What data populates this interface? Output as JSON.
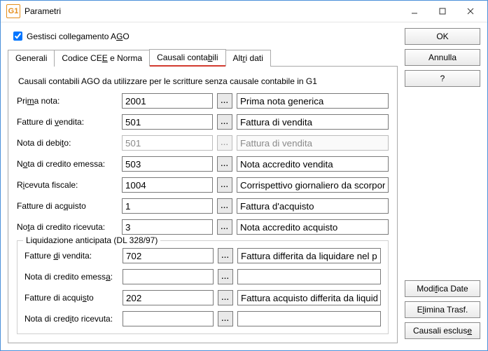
{
  "window": {
    "title": "Parametri",
    "app_icon": "G1"
  },
  "checkbox": {
    "label_pre": "Gestisci collegamento A",
    "label_u": "G",
    "label_post": "O"
  },
  "tabs": {
    "generali": "Generali",
    "codice_pre": "Codice CE",
    "codice_u": "E",
    "codice_post": " e Norma",
    "causali_pre": "Causali conta",
    "causali_u": "b",
    "causali_post": "ili",
    "altri_pre": "Alt",
    "altri_u": "r",
    "altri_post": "i dati"
  },
  "instr": "Causali contabili AGO da utilizzare per le scritture senza causale contabile in G1",
  "rows": {
    "prima": {
      "lbl_pre": "Pri",
      "lbl_u": "m",
      "lbl_post": "a nota:",
      "code": "2001",
      "desc": "Prima nota generica"
    },
    "fvend": {
      "lbl_pre": "Fatture di ",
      "lbl_u": "v",
      "lbl_post": "endita:",
      "code": "501",
      "desc": "Fattura di vendita"
    },
    "ndeb": {
      "lbl_pre": "Nota di debi",
      "lbl_u": "t",
      "lbl_post": "o:",
      "code": "501",
      "desc": "Fattura di vendita"
    },
    "ncem": {
      "lbl_pre": "N",
      "lbl_u": "o",
      "lbl_post": "ta di credito emessa:",
      "code": "503",
      "desc": "Nota accredito vendita"
    },
    "rfisc": {
      "lbl_pre": "R",
      "lbl_u": "i",
      "lbl_post": "cevuta fiscale:",
      "code": "1004",
      "desc": "Corrispettivo giornaliero da scorpora"
    },
    "facq": {
      "lbl_pre": "Fatture di ac",
      "lbl_u": "q",
      "lbl_post": "uisto",
      "code": "1",
      "desc": "Fattura d'acquisto"
    },
    "ncric": {
      "lbl_pre": "No",
      "lbl_u": "t",
      "lbl_post": "a di credito ricevuta:",
      "code": "3",
      "desc": "Nota accredito acquisto"
    }
  },
  "group": {
    "legend": "Liquidazione anticipata (DL 328/97)",
    "fvend": {
      "lbl_pre": "Fatture ",
      "lbl_u": "d",
      "lbl_post": "i vendita:",
      "code": "702",
      "desc": "Fattura differita da liquidare nel p"
    },
    "ncem": {
      "lbl_pre": "Nota di credito emess",
      "lbl_u": "a",
      "lbl_post": ":",
      "code": "",
      "desc": ""
    },
    "facq": {
      "lbl_pre": "Fatture di acqui",
      "lbl_u": "s",
      "lbl_post": "to",
      "code": "202",
      "desc": "Fattura acquisto differita da liquid"
    },
    "ncric": {
      "lbl_pre": "Nota di cred",
      "lbl_u": "i",
      "lbl_post": "to ricevuta:",
      "code": "",
      "desc": ""
    }
  },
  "buttons": {
    "ok": "OK",
    "annulla": "Annulla",
    "help": "?",
    "mod_pre": "Modi",
    "mod_u": "f",
    "mod_post": "ica Date",
    "elim_pre": "E",
    "elim_u": "l",
    "elim_post": "imina Trasf.",
    "esc_pre": "Causali esclus",
    "esc_u": "e",
    "esc_post": ""
  },
  "ui": {
    "ellipsis": "..."
  }
}
